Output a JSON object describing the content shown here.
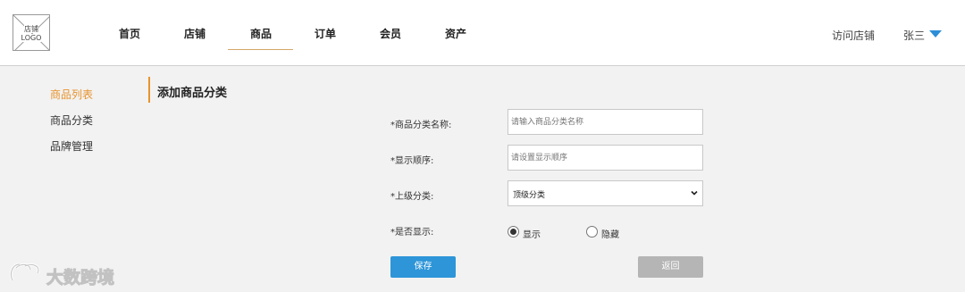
{
  "header": {
    "logo_text": "店铺\nLOGO",
    "nav": [
      {
        "label": "首页"
      },
      {
        "label": "店铺"
      },
      {
        "label": "商品"
      },
      {
        "label": "订单"
      },
      {
        "label": "会员"
      },
      {
        "label": "资产"
      }
    ],
    "active_nav": "商品",
    "visit_store": "访问店铺",
    "user_name": "张三"
  },
  "sidebar": {
    "items": [
      {
        "label": "商品列表",
        "active": true
      },
      {
        "label": "商品分类",
        "active": false
      },
      {
        "label": "品牌管理",
        "active": false
      }
    ]
  },
  "form": {
    "title": "添加商品分类",
    "name_label": "*商品分类名称:",
    "name_placeholder": "请输入商品分类名称",
    "order_label": "*显示顺序:",
    "order_placeholder": "请设置显示顺序",
    "parent_label": "*上级分类:",
    "parent_value": "顶级分类",
    "visible_label": "*是否显示:",
    "visible_options": [
      {
        "label": "显示",
        "selected": true
      },
      {
        "label": "隐藏",
        "selected": false
      }
    ],
    "save_label": "保存",
    "back_label": "返回"
  },
  "watermark": {
    "text": "大数跨境"
  },
  "colors": {
    "accent_orange": "#e8932d",
    "primary_blue": "#2d95d8",
    "disabled_gray": "#b5b5b5"
  }
}
